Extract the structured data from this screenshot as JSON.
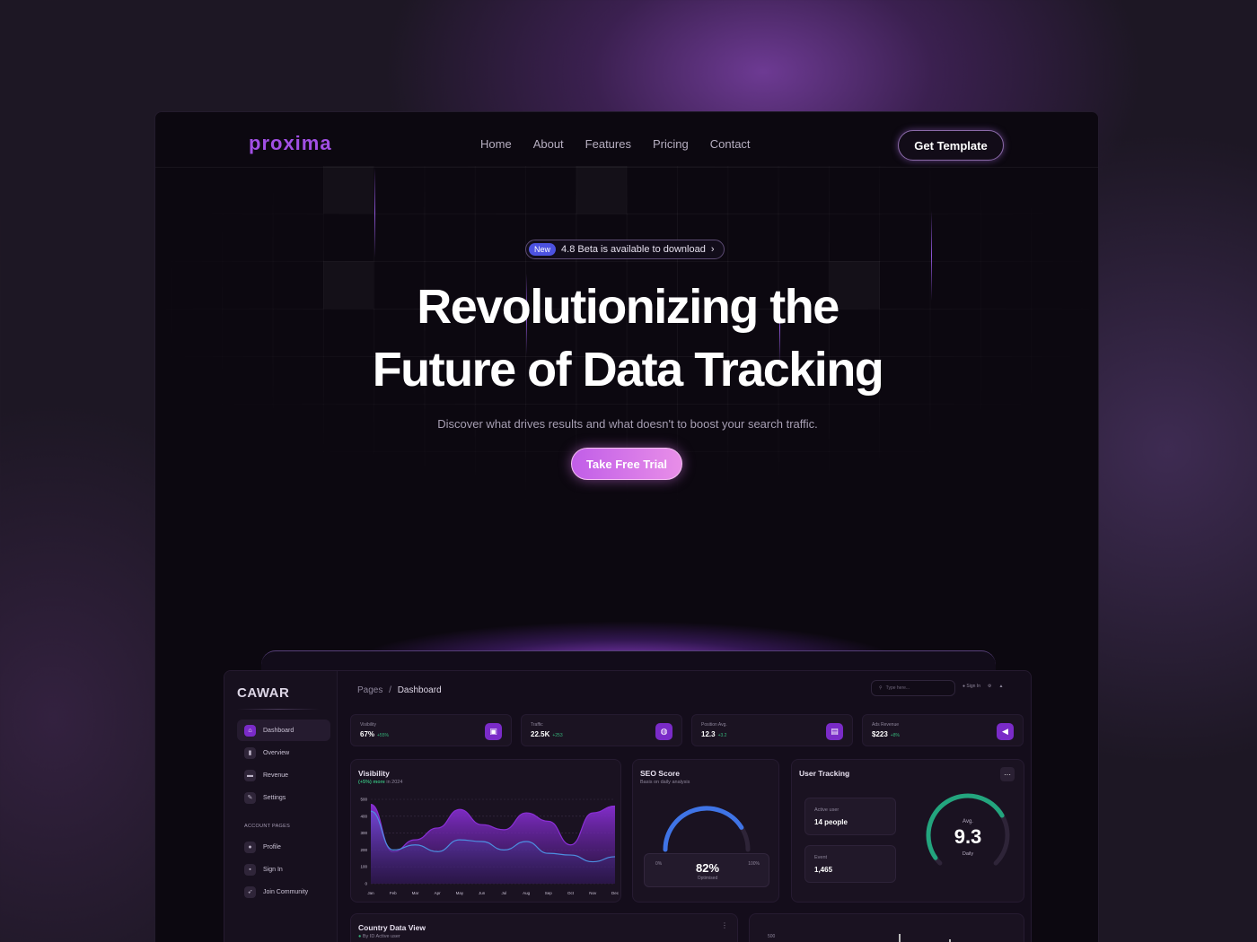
{
  "brand": "proxima",
  "nav": {
    "links": [
      "Home",
      "About",
      "Features",
      "Pricing",
      "Contact"
    ],
    "cta": "Get Template"
  },
  "announcement": {
    "badge": "New",
    "text": "4.8 Beta is available to download",
    "arrow": "›"
  },
  "hero": {
    "title_line1": "Revolutionizing the",
    "title_line2": "Future of Data Tracking",
    "subtitle": "Discover what drives results and what doesn't to boost your search traffic.",
    "cta": "Take Free Trial"
  },
  "dashboard": {
    "brand": "CAWAR",
    "breadcrumb": {
      "root": "Pages",
      "separator": "/",
      "current": "Dashboard"
    },
    "search_placeholder": "Type here...",
    "sign_in": "Sign In",
    "sidebar": {
      "items": [
        "Dashboard",
        "Overview",
        "Revenue",
        "Settings"
      ],
      "section_label": "ACCOUNT PAGES",
      "account_items": [
        "Profile",
        "Sign In",
        "Join Community"
      ]
    },
    "stats": [
      {
        "label": "Visibility",
        "value": "67%",
        "delta": "+55%"
      },
      {
        "label": "Traffic",
        "value": "22.5K",
        "delta": "+253"
      },
      {
        "label": "Position Avg.",
        "value": "12.3",
        "delta": "+3.2"
      },
      {
        "label": "Ads Revenue",
        "value": "$223",
        "delta": "+8%"
      }
    ],
    "visibility": {
      "title": "Visibility",
      "sub_highlight": "(+5%) more",
      "sub_rest": "in 2024"
    },
    "seo": {
      "title": "SEO Score",
      "sub": "Basis on daily analysis",
      "value": "82%",
      "caption": "Optimised",
      "min": "0%",
      "max": "100%",
      "fraction": 0.82
    },
    "user_tracking": {
      "title": "User Tracking",
      "more": "···",
      "active_label": "Active user",
      "active_value": "14 people",
      "event_label": "Event",
      "event_value": "1,465",
      "avg_label": "Avg.",
      "avg_value": "9.3",
      "avg_caption": "Daily"
    },
    "country": {
      "title": "Country Data View",
      "sub": "By ID Active user",
      "more": "⋮"
    },
    "bottom_axis_label": "500"
  },
  "chart_data": {
    "type": "area",
    "categories": [
      "Jan",
      "Feb",
      "Mar",
      "Apr",
      "May",
      "Jun",
      "Jul",
      "Aug",
      "Sep",
      "Oct",
      "Nov",
      "Dec"
    ],
    "yticks": [
      "500",
      "400",
      "300",
      "200",
      "100",
      "0"
    ],
    "ylim": [
      0,
      500
    ],
    "series": [
      {
        "values": [
          470,
          190,
          260,
          330,
          440,
          350,
          320,
          420,
          370,
          230,
          420,
          460
        ],
        "color": "#8a2fd6"
      },
      {
        "values": [
          430,
          200,
          230,
          190,
          260,
          250,
          200,
          250,
          180,
          170,
          130,
          160
        ],
        "color": "#4c8fe0"
      }
    ]
  },
  "colors": {
    "accent": "#a14fe4",
    "button_purple": "#7a2bc8",
    "positive": "#35b57a",
    "seo_arc": "#3f74e6",
    "gauge_arc": "#23a57e"
  }
}
